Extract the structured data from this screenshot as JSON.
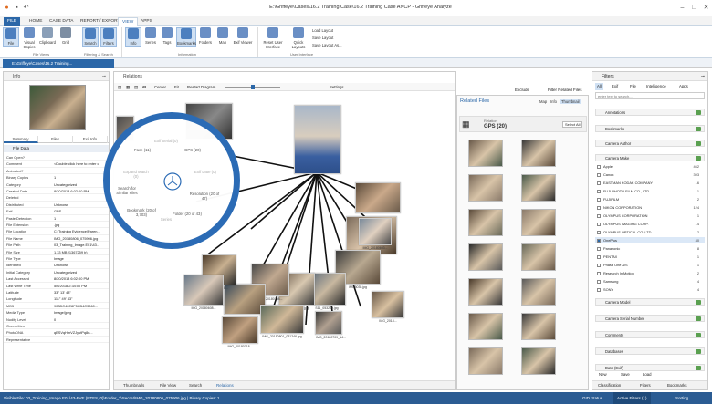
{
  "window": {
    "title": "E:\\Griffeye\\Cases\\16.2 Training Case\\16.2 Training Case ANCP - Griffeye Analyze"
  },
  "ribbon": {
    "tabs": [
      "FILE",
      "HOME",
      "CASE DATA",
      "REPORT / EXPORT",
      "VIEW",
      "APPS"
    ],
    "active_tab": "VIEW",
    "search_placeholder": "Search (F3)",
    "buttons": [
      {
        "label": "File"
      },
      {
        "label": "Visual Copies"
      },
      {
        "label": "Clipboard"
      },
      {
        "label": "Grid"
      },
      {
        "label": "Search"
      },
      {
        "label": "Filters"
      },
      {
        "label": "Info"
      },
      {
        "label": "Series"
      },
      {
        "label": "Tags"
      },
      {
        "label": "Bookmarks"
      },
      {
        "label": "Folders"
      },
      {
        "label": "Map"
      },
      {
        "label": "Exif Viewer"
      },
      {
        "label": "Reset User Interface"
      },
      {
        "label": "Quick Layouts"
      }
    ],
    "layout_links": [
      "Load Layout",
      "Save Layout",
      "Save Layout As..."
    ],
    "groups": [
      "File Views",
      "Filtering & Search",
      "Information",
      "User Interface"
    ]
  },
  "path_tab": "E:\\Griffeye\\Cases\\16.2 Training...",
  "info_panel": {
    "title": "Info",
    "tabs": [
      "Summary",
      "Files",
      "Exif Info"
    ],
    "file_data_title": "File Data",
    "rows": [
      {
        "k": "Can Open?",
        "v": ""
      },
      {
        "k": "Comment",
        "v": "<Double click here to enter c"
      },
      {
        "k": "Animated?",
        "v": ""
      },
      {
        "k": "Binary Copies",
        "v": "1"
      },
      {
        "k": "Category",
        "v": "Uncategorized"
      },
      {
        "k": "Created Date",
        "v": "8/20/2018 6:02:00 PM"
      },
      {
        "k": "Deleted",
        "v": ""
      },
      {
        "k": "Distributed",
        "v": "Unknown"
      },
      {
        "k": "Exif",
        "v": "GPS"
      },
      {
        "k": "Paste Detection",
        "v": "1"
      },
      {
        "k": "File Extension",
        "v": ".jpg"
      },
      {
        "k": "File Location",
        "v": "C:\\Training Evidence\\Paren..."
      },
      {
        "k": "File Name",
        "v": "IMG_20180806_075906.jpg"
      },
      {
        "k": "File Path",
        "v": "03_Training_Image.E01\\43..."
      },
      {
        "k": "File Size",
        "v": "1.33 MB (1367259 b)"
      },
      {
        "k": "File Type",
        "v": "Image"
      },
      {
        "k": "Identified",
        "v": "Unknown"
      },
      {
        "k": "Initial Category",
        "v": "Uncategorized"
      },
      {
        "k": "Last Accessed",
        "v": "8/20/2018 6:02:00 PM"
      },
      {
        "k": "Last Write Time",
        "v": "5/6/2018 2:34:00 PM"
      },
      {
        "k": "Latitude",
        "v": "33° 13' 48\""
      },
      {
        "k": "Longitude",
        "v": "111° 49' 43\""
      },
      {
        "k": "MD5",
        "v": "903DC40E8F5CB4C3860..."
      },
      {
        "k": "Media Type",
        "v": "Image/jpeg"
      },
      {
        "k": "Nudity Level",
        "v": "0"
      },
      {
        "k": "Overwritten",
        "v": ""
      },
      {
        "k": "PhotoDNA",
        "v": "qESVqHmVZJyutPq8n..."
      },
      {
        "k": "Representative",
        "v": ""
      }
    ]
  },
  "relations": {
    "title": "Relations",
    "toolbar": [
      "Center",
      "Fit",
      "Restart Diagram",
      "Settings"
    ],
    "menu": {
      "items": [
        "Face (11)",
        "Exif Serial (0)",
        "GPS (20)",
        "Exif Date (0)",
        "Resolution (20 of 47)",
        "Folder (20 of 43)",
        "Series",
        "Bookmark (20 of 3,703)",
        "Search for Similar Files",
        "Expand Match (0)"
      ]
    },
    "captions": [
      "IMG_2018...",
      "IMG_20180718...",
      "IMG_20180801_031246.jpg",
      "IMG_20180603...",
      "IMG_20180608...",
      "IMG_20180709_14...",
      "IMG_2018...",
      "IMG_20180607...",
      "IMG_20180708...",
      "BH4_104940.jpg",
      "S11_053209.jpg",
      "IMG5035.jpg",
      "IMG_2018..."
    ],
    "bottom_tabs": [
      "Thumbnails",
      "File View",
      "Search",
      "Relations"
    ]
  },
  "related_files": {
    "title": "Related Files",
    "exclude_label": "Exclude",
    "filter_label": "Filter Related Files",
    "views": [
      "Map",
      "Info",
      "Thumbnail"
    ],
    "relation_label": "Relation",
    "relation_value": "GPS (20)",
    "select_all": "Select All"
  },
  "filters": {
    "title": "Filters",
    "tabs": [
      "All",
      "Exif",
      "File",
      "Intelligence",
      "Apps"
    ],
    "search_placeholder": "enter text to search...",
    "sections": [
      "Annotations",
      "Bookmarks",
      "Camera Author",
      "Camera Make",
      "Camera Model",
      "Camera Serial Number",
      "Comments",
      "Databases",
      "Date (Exif)"
    ],
    "makes": [
      {
        "label": "Apple",
        "count": "462"
      },
      {
        "label": "Canon",
        "count": "393"
      },
      {
        "label": "EASTMAN KODAK COMPANY",
        "count": "16"
      },
      {
        "label": "FUJI PHOTO FILM CO., LTD.",
        "count": "1"
      },
      {
        "label": "FUJIFILM",
        "count": "2"
      },
      {
        "label": "NIKON CORPORATION",
        "count": "124"
      },
      {
        "label": "OLYMPUS CORPORATION",
        "count": "1"
      },
      {
        "label": "OLYMPUS IMAGING CORP.",
        "count": "14"
      },
      {
        "label": "OLYMPUS OPTICAL CO.,LTD",
        "count": "2"
      },
      {
        "label": "OnePlus",
        "count": "40"
      },
      {
        "label": "Panasonic",
        "count": "8"
      },
      {
        "label": "PENTAX",
        "count": "1"
      },
      {
        "label": "Phase One A/S",
        "count": "1"
      },
      {
        "label": "Research In Motion",
        "count": "2"
      },
      {
        "label": "Samsung",
        "count": "4"
      },
      {
        "label": "SONY",
        "count": "4"
      }
    ],
    "selected_make": "OnePlus",
    "bottom_actions": [
      "New",
      "Save",
      "Load"
    ],
    "bottom_tabs": [
      "Classification",
      "Filters",
      "Bookmarks"
    ]
  },
  "status": {
    "text": "Visible File: 03_Training_Image.E01\\43-FVE (NTFS, 0)\\Folder_2\\Secret\\IMG_20180806_075906.jpg | Binary Copies: 1",
    "gpu": "GID Status",
    "active_filters": "Active Filters (1)",
    "sorting": "Sorting"
  },
  "colors": {
    "accent": "#2b67a8",
    "circle": "#2b6bb5",
    "status": "#2b5c93"
  }
}
